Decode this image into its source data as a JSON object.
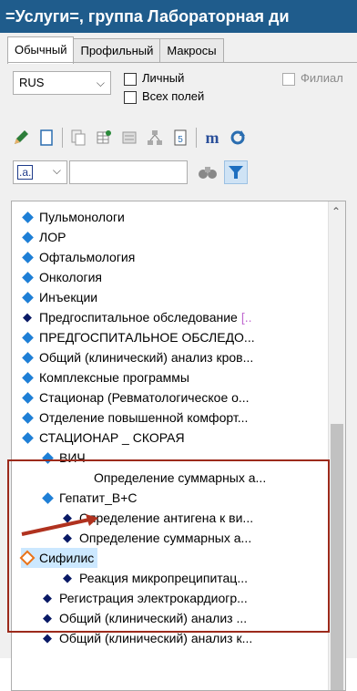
{
  "window": {
    "title": "=Услуги=, группа Лабораторная ди"
  },
  "tabs": [
    {
      "label": "Обычный",
      "active": true
    },
    {
      "label": "Профильный",
      "active": false
    },
    {
      "label": "Макросы",
      "active": false
    }
  ],
  "filters": {
    "language": "RUS",
    "personal_label": "Личный",
    "all_fields_label": "Всех полей",
    "branch_label": "Филиал"
  },
  "toolbar": {
    "icons": [
      "pencil-icon",
      "page-icon",
      "copy-page-icon",
      "grid-add-icon",
      "report-icon",
      "flowchart-icon",
      "calendar-icon",
      "m-icon",
      "refresh-icon"
    ]
  },
  "search": {
    "format_label": ".a.",
    "query": ""
  },
  "tree": {
    "items": [
      {
        "label": "Пульмонологи",
        "icon": "diamond"
      },
      {
        "label": "ЛОР",
        "icon": "diamond"
      },
      {
        "label": "Офтальмология",
        "icon": "diamond"
      },
      {
        "label": "Онкология",
        "icon": "diamond"
      },
      {
        "label": "Инъекции",
        "icon": "diamond"
      },
      {
        "label": "Предгоспитальное обследование",
        "icon": "arrow",
        "suffix": "[.."
      },
      {
        "label": "ПРЕДГОСПИТАЛЬНОЕ ОБСЛЕДО...",
        "icon": "diamond"
      },
      {
        "label": "Общий (клинический) анализ кров...",
        "icon": "diamond"
      },
      {
        "label": "Комплексные программы",
        "icon": "diamond"
      },
      {
        "label": "Стационар (Ревматологическое о...",
        "icon": "diamond"
      },
      {
        "label": "Отделение повышенной комфорт...",
        "icon": "diamond"
      },
      {
        "label": "СТАЦИОНАР _ СКОРАЯ",
        "icon": "diamond"
      },
      {
        "label": "ВИЧ",
        "icon": "diamond"
      },
      {
        "label": "Определение суммарных а...",
        "icon": "none"
      },
      {
        "label": "Гепатит_В+С",
        "icon": "diamond"
      },
      {
        "label": "Определение антигена к ви...",
        "icon": "arrow"
      },
      {
        "label": "Определение суммарных а...",
        "icon": "arrow"
      },
      {
        "label": "Сифилис",
        "icon": "diamond-selected"
      },
      {
        "label": "Реакция микропреципитац...",
        "icon": "arrow"
      },
      {
        "label": "Регистрация электрокардиогр...",
        "icon": "arrow"
      },
      {
        "label": "Общий (клинический) анализ ...",
        "icon": "arrow"
      },
      {
        "label": "Общий (клинический) анализ к...",
        "icon": "arrow"
      }
    ]
  },
  "colors": {
    "titlebar": "#1f5c8c",
    "annotation": "#9c2a1b",
    "diamond": "#1e7fd6",
    "selected": "#e8731a"
  }
}
